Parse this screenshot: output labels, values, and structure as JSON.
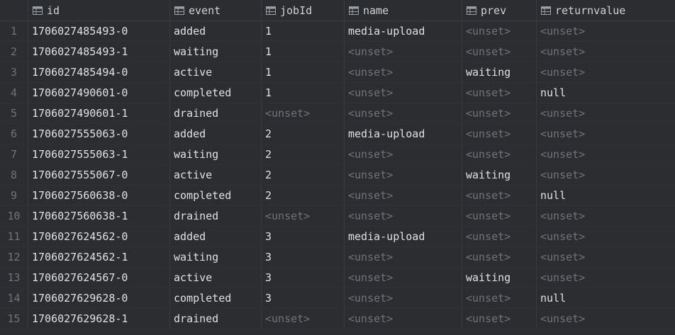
{
  "columns": [
    "id",
    "event",
    "jobId",
    "name",
    "prev",
    "returnvalue"
  ],
  "rows": [
    {
      "n": "1",
      "id": "1706027485493-0",
      "event": "added",
      "jobId": "1",
      "name": "media-upload",
      "prev": "<unset>",
      "returnvalue": "<unset>"
    },
    {
      "n": "2",
      "id": "1706027485493-1",
      "event": "waiting",
      "jobId": "1",
      "name": "<unset>",
      "prev": "<unset>",
      "returnvalue": "<unset>"
    },
    {
      "n": "3",
      "id": "1706027485494-0",
      "event": "active",
      "jobId": "1",
      "name": "<unset>",
      "prev": "waiting",
      "returnvalue": "<unset>"
    },
    {
      "n": "4",
      "id": "1706027490601-0",
      "event": "completed",
      "jobId": "1",
      "name": "<unset>",
      "prev": "<unset>",
      "returnvalue": "null"
    },
    {
      "n": "5",
      "id": "1706027490601-1",
      "event": "drained",
      "jobId": "<unset>",
      "name": "<unset>",
      "prev": "<unset>",
      "returnvalue": "<unset>"
    },
    {
      "n": "6",
      "id": "1706027555063-0",
      "event": "added",
      "jobId": "2",
      "name": "media-upload",
      "prev": "<unset>",
      "returnvalue": "<unset>"
    },
    {
      "n": "7",
      "id": "1706027555063-1",
      "event": "waiting",
      "jobId": "2",
      "name": "<unset>",
      "prev": "<unset>",
      "returnvalue": "<unset>"
    },
    {
      "n": "8",
      "id": "1706027555067-0",
      "event": "active",
      "jobId": "2",
      "name": "<unset>",
      "prev": "waiting",
      "returnvalue": "<unset>"
    },
    {
      "n": "9",
      "id": "1706027560638-0",
      "event": "completed",
      "jobId": "2",
      "name": "<unset>",
      "prev": "<unset>",
      "returnvalue": "null"
    },
    {
      "n": "10",
      "id": "1706027560638-1",
      "event": "drained",
      "jobId": "<unset>",
      "name": "<unset>",
      "prev": "<unset>",
      "returnvalue": "<unset>"
    },
    {
      "n": "11",
      "id": "1706027624562-0",
      "event": "added",
      "jobId": "3",
      "name": "media-upload",
      "prev": "<unset>",
      "returnvalue": "<unset>"
    },
    {
      "n": "12",
      "id": "1706027624562-1",
      "event": "waiting",
      "jobId": "3",
      "name": "<unset>",
      "prev": "<unset>",
      "returnvalue": "<unset>"
    },
    {
      "n": "13",
      "id": "1706027624567-0",
      "event": "active",
      "jobId": "3",
      "name": "<unset>",
      "prev": "waiting",
      "returnvalue": "<unset>"
    },
    {
      "n": "14",
      "id": "1706027629628-0",
      "event": "completed",
      "jobId": "3",
      "name": "<unset>",
      "prev": "<unset>",
      "returnvalue": "null"
    },
    {
      "n": "15",
      "id": "1706027629628-1",
      "event": "drained",
      "jobId": "<unset>",
      "name": "<unset>",
      "prev": "<unset>",
      "returnvalue": "<unset>"
    }
  ],
  "icons": {
    "column_header": "table-column-icon"
  },
  "colors": {
    "background": "#2b2d30",
    "text": "#dfe1e5",
    "muted": "#6f737a",
    "gridline": "#393b40",
    "icon": "#9aa0a6"
  }
}
